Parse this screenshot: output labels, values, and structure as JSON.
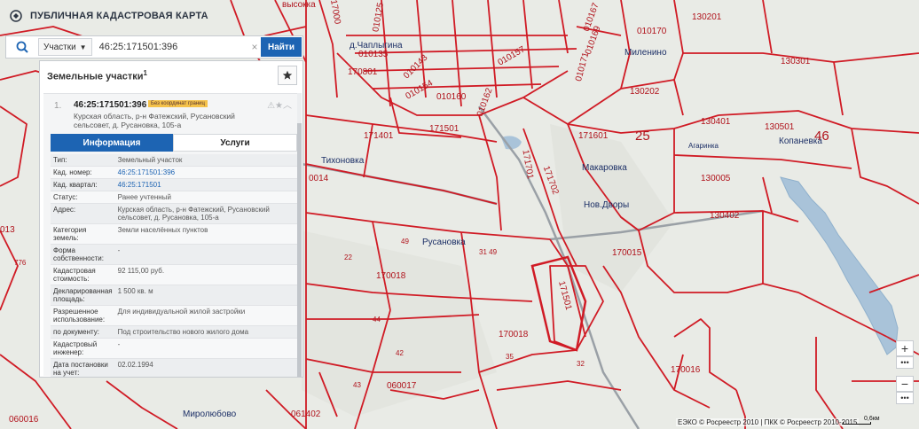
{
  "app": {
    "title": "ПУБЛИЧНАЯ КАДАСТРОВАЯ КАРТА"
  },
  "search": {
    "type_label": "Участки",
    "query": "46:25:171501:396",
    "button_label": "Найти"
  },
  "panel": {
    "title": "Земельные участки",
    "count": "1",
    "result": {
      "index": "1.",
      "cad_number": "46:25:171501:396",
      "badge": "Без координат границ",
      "address": "Курская область, р-н Фатежский, Русановский сельсовет, д. Русановка, 105-а"
    },
    "tabs": {
      "info": "Информация",
      "services": "Услуги"
    },
    "rows": [
      {
        "key": "Тип:",
        "value": "Земельный участок"
      },
      {
        "key": "Кад. номер:",
        "value": "46:25:171501:396"
      },
      {
        "key": "Кад. квартал:",
        "value": "46:25:171501"
      },
      {
        "key": "Статус:",
        "value": "Ранее учтенный"
      },
      {
        "key": "Адрес:",
        "value": "Курская область, р-н Фатежский, Русановский сельсовет, д. Русановка, 105-а"
      },
      {
        "key": "Категория земель:",
        "value": "Земли населённых пунктов"
      },
      {
        "key": "Форма собственности:",
        "value": "-"
      },
      {
        "key": "Кадастровая стоимость:",
        "value": "92 115,00 руб."
      },
      {
        "key": "Декларированная площадь:",
        "value": "1 500 кв. м"
      },
      {
        "key": "Разрешенное использование:",
        "value": "Для индивидуальной жилой застройки"
      },
      {
        "key": "по документу:",
        "value": "Под строительство нового жилого дома"
      },
      {
        "key": "Кадастровый инженер:",
        "value": "-"
      },
      {
        "key": "Дата постановки на учет:",
        "value": "02.02.1994"
      }
    ]
  },
  "map": {
    "labels": [
      {
        "text": "высокка",
        "kind": "code"
      },
      {
        "text": "17000",
        "kind": "code"
      },
      {
        "text": "010125",
        "kind": "code"
      },
      {
        "text": "010167",
        "kind": "code"
      },
      {
        "text": "010170",
        "kind": "code"
      },
      {
        "text": "130201",
        "kind": "code"
      },
      {
        "text": "д.Чаплыгина",
        "kind": "place"
      },
      {
        "text": "010135",
        "kind": "code"
      },
      {
        "text": "Миленино",
        "kind": "place"
      },
      {
        "text": "130301",
        "kind": "code"
      },
      {
        "text": "170801",
        "kind": "code"
      },
      {
        "text": "010143",
        "kind": "code"
      },
      {
        "text": "010169",
        "kind": "code"
      },
      {
        "text": "010157",
        "kind": "code"
      },
      {
        "text": "010171",
        "kind": "code"
      },
      {
        "text": "010154",
        "kind": "code"
      },
      {
        "text": "010160",
        "kind": "code"
      },
      {
        "text": "010162",
        "kind": "code"
      },
      {
        "text": "130202",
        "kind": "code"
      },
      {
        "text": "171501",
        "kind": "code"
      },
      {
        "text": "171401",
        "kind": "code"
      },
      {
        "text": "171601",
        "kind": "code"
      },
      {
        "text": "25",
        "kind": "num"
      },
      {
        "text": "130401",
        "kind": "code"
      },
      {
        "text": "130501",
        "kind": "code"
      },
      {
        "text": "Копаневка",
        "kind": "place"
      },
      {
        "text": "46",
        "kind": "num"
      },
      {
        "text": "Агаринка",
        "kind": "place"
      },
      {
        "text": "Тихоновка",
        "kind": "place"
      },
      {
        "text": "171701",
        "kind": "code"
      },
      {
        "text": "Макаровка",
        "kind": "place"
      },
      {
        "text": "171702",
        "kind": "code"
      },
      {
        "text": "130005",
        "kind": "code"
      },
      {
        "text": "0014",
        "kind": "code"
      },
      {
        "text": "Нов.Дворы",
        "kind": "place"
      },
      {
        "text": "130402",
        "kind": "code"
      },
      {
        "text": "013",
        "kind": "code"
      },
      {
        "text": "49",
        "kind": "code"
      },
      {
        "text": "Русановка",
        "kind": "place"
      },
      {
        "text": "31 49",
        "kind": "code"
      },
      {
        "text": "22",
        "kind": "code"
      },
      {
        "text": "170015",
        "kind": "code"
      },
      {
        "text": "776",
        "kind": "code"
      },
      {
        "text": "170018",
        "kind": "code"
      },
      {
        "text": "171501",
        "kind": "code"
      },
      {
        "text": "44",
        "kind": "code"
      },
      {
        "text": "170018",
        "kind": "code"
      },
      {
        "text": "42",
        "kind": "code"
      },
      {
        "text": "35",
        "kind": "code"
      },
      {
        "text": "32",
        "kind": "code"
      },
      {
        "text": "170016",
        "kind": "code"
      },
      {
        "text": "43",
        "kind": "code"
      },
      {
        "text": "060017",
        "kind": "code"
      },
      {
        "text": "060016",
        "kind": "code"
      },
      {
        "text": "Миролюбово",
        "kind": "place"
      },
      {
        "text": "061402",
        "kind": "code"
      }
    ]
  },
  "footer": {
    "text": "ЕЭКО © Росреестр 2010 | ПКК © Росреестр 2010-2015"
  },
  "scale": {
    "label": "0,6км"
  },
  "controls": {
    "zoom_in": "+",
    "zoom_out": "−",
    "more": "•••"
  },
  "colors": {
    "boundary": "#d01b25",
    "accent": "#1d64b3",
    "water": "#a9c3d9",
    "terrain": "#e9ebe6"
  }
}
